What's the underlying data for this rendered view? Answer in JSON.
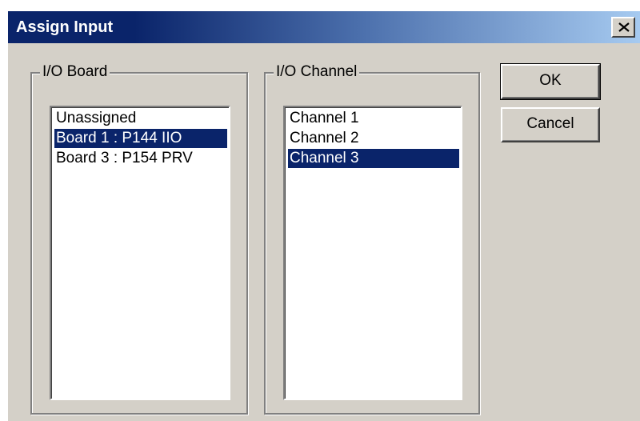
{
  "dialog": {
    "title": "Assign Input"
  },
  "board_group": {
    "label": "I/O Board",
    "items": [
      {
        "label": "Unassigned",
        "selected": false
      },
      {
        "label": "Board 1 : P144 IIO",
        "selected": true
      },
      {
        "label": "Board 3 : P154 PRV",
        "selected": false
      }
    ]
  },
  "channel_group": {
    "label": "I/O Channel",
    "items": [
      {
        "label": "Channel 1",
        "selected": false
      },
      {
        "label": "Channel 2",
        "selected": false
      },
      {
        "label": "Channel 3",
        "selected": true
      }
    ]
  },
  "buttons": {
    "ok_label": "OK",
    "cancel_label": "Cancel"
  },
  "icons": {
    "close": "close-icon"
  },
  "colors": {
    "title_bar_start": "#0a246a",
    "title_bar_end": "#a6caf0",
    "dialog_face": "#d4d0c8",
    "selection": "#0a246a",
    "list_background": "#ffffff"
  }
}
